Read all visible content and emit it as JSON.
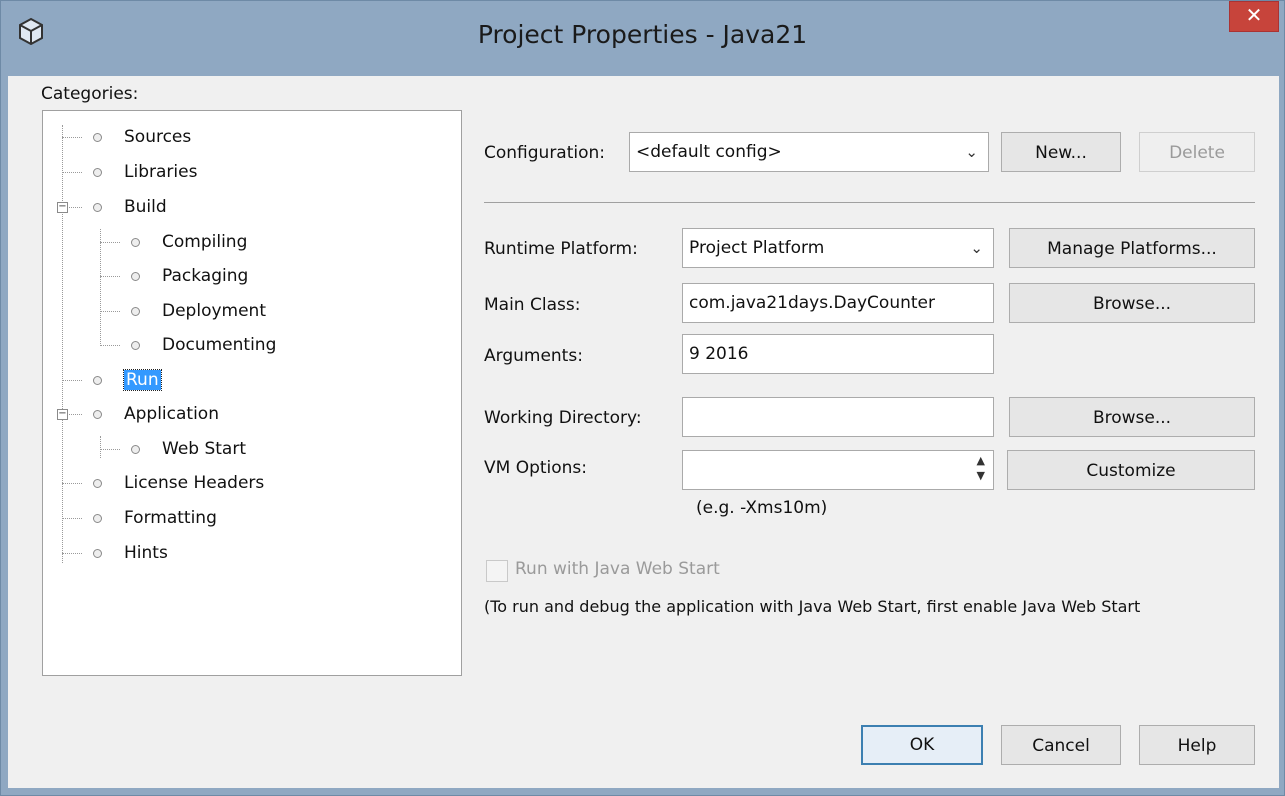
{
  "window": {
    "title": "Project Properties - Java21",
    "close_glyph": "✕"
  },
  "categories": {
    "label": "Categories:",
    "items": [
      "Sources",
      "Libraries",
      "Build",
      "Compiling",
      "Packaging",
      "Deployment",
      "Documenting",
      "Run",
      "Application",
      "Web Start",
      "License Headers",
      "Formatting",
      "Hints"
    ],
    "selected": "Run"
  },
  "config": {
    "label": "Configuration:",
    "value": "<default config>",
    "new_label": "New...",
    "delete_label": "Delete"
  },
  "form": {
    "runtime_label": "Runtime Platform:",
    "runtime_value": "Project Platform",
    "manage_label": "Manage Platforms...",
    "main_class_label": "Main Class:",
    "main_class_value": "com.java21days.DayCounter",
    "browse_label": "Browse...",
    "arguments_label": "Arguments:",
    "arguments_value": "9 2016",
    "working_dir_label": "Working Directory:",
    "working_dir_value": "",
    "browse2_label": "Browse...",
    "vm_options_label": "VM Options:",
    "vm_options_value": "",
    "customize_label": "Customize",
    "vm_hint": "(e.g. -Xms10m)",
    "webstart_checkbox_label": "Run with Java Web Start",
    "webstart_note": "(To run and debug the application with Java Web Start, first enable Java Web Start"
  },
  "footer": {
    "ok_label": "OK",
    "cancel_label": "Cancel",
    "help_label": "Help"
  },
  "icons": {
    "app": "netbeans-cube-icon",
    "dropdown": "chevron-down-icon",
    "spinner": "up-down-arrows-icon",
    "close": "close-icon"
  },
  "colors": {
    "selection": "#3399ff",
    "close_button": "#c7443b",
    "titlebar": "#8fa8c2"
  }
}
